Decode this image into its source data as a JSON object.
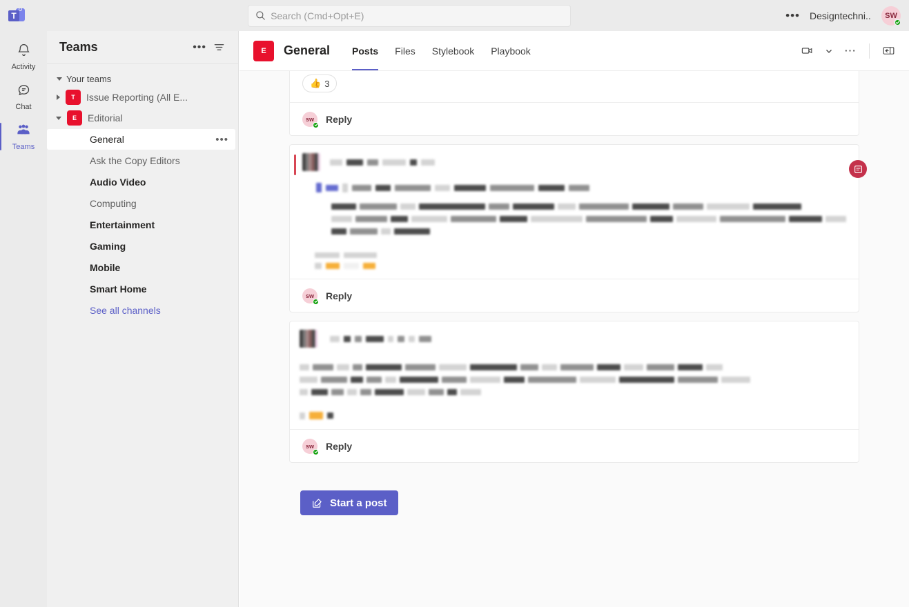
{
  "app": {
    "logo_letter": "T",
    "accent_color": "#5B5FC7",
    "team_avatar_color": "#E8112D",
    "important_color": "#C4314B"
  },
  "topbar": {
    "more_label": "•••",
    "search": {
      "placeholder": "Search (Cmd+Opt+E)",
      "value": "",
      "icon": "search-icon"
    },
    "org_name": "Designtechni...",
    "user_avatar_initials": "SW",
    "presence": "available"
  },
  "rail": {
    "items": [
      {
        "label": "Activity",
        "icon": "bell-icon",
        "active": false
      },
      {
        "label": "Chat",
        "icon": "chat-bubble-icon",
        "active": false
      },
      {
        "label": "Teams",
        "icon": "people-icon",
        "active": true
      }
    ]
  },
  "sidebar": {
    "title": "Teams",
    "more_label": "•••",
    "filter_icon": "filter-icon",
    "section_label": "Your teams",
    "teams": [
      {
        "name": "Issue Reporting (All E...",
        "avatar_letter": "T",
        "expanded": false
      },
      {
        "name": "Editorial",
        "avatar_letter": "E",
        "expanded": true
      }
    ],
    "channels": [
      {
        "name": "General",
        "state": "selected",
        "more_label": "•••"
      },
      {
        "name": "Ask the Copy Editors",
        "state": "read"
      },
      {
        "name": "Audio Video",
        "state": "unread"
      },
      {
        "name": "Computing",
        "state": "read"
      },
      {
        "name": "Entertainment",
        "state": "unread"
      },
      {
        "name": "Gaming",
        "state": "unread"
      },
      {
        "name": "Mobile",
        "state": "unread"
      },
      {
        "name": "Smart Home",
        "state": "unread"
      }
    ],
    "see_all_label": "See all channels"
  },
  "channel_header": {
    "avatar_letter": "E",
    "title": "General",
    "tabs": [
      {
        "label": "Posts",
        "active": true
      },
      {
        "label": "Files",
        "active": false
      },
      {
        "label": "Stylebook",
        "active": false
      },
      {
        "label": "Playbook",
        "active": false
      }
    ],
    "actions": [
      {
        "name": "meet-now-icon"
      },
      {
        "name": "chevron-down-icon"
      },
      {
        "name": "more-options-icon"
      },
      {
        "name": "open-chat-panel-icon"
      }
    ]
  },
  "posts": [
    {
      "id": "post-1",
      "important": false,
      "has_image": true,
      "reaction": {
        "emoji": "👍",
        "count": "3"
      },
      "reply": {
        "avatar_initials": "sw",
        "label": "Reply"
      }
    },
    {
      "id": "post-2",
      "important": true,
      "important_icon": "announcement-icon",
      "has_image": false,
      "reply": {
        "avatar_initials": "sw",
        "label": "Reply"
      }
    },
    {
      "id": "post-3",
      "important": false,
      "has_image": false,
      "reply": {
        "avatar_initials": "sw",
        "label": "Reply"
      }
    }
  ],
  "compose": {
    "start_post_label": "Start a post",
    "icon": "compose-icon"
  }
}
